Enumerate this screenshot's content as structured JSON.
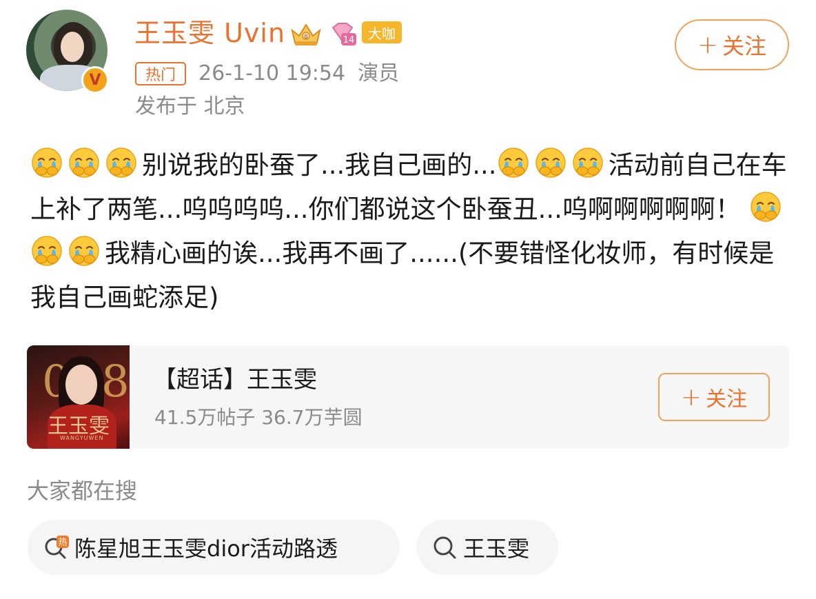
{
  "header": {
    "username": "王玉雯 Uvin",
    "member_tag": "大咖",
    "diamond_level": "14",
    "hot_tag": "热门",
    "timestamp": "26-1-10 19:54",
    "profession": "演员",
    "location": "发布于 北京",
    "follow_label": "关注",
    "verified_badge": "V"
  },
  "post": {
    "segments": {
      "s1": "别说我的卧蚕了...我自己画的...",
      "s2": "活动前自己在车上补了两笔...呜呜呜呜...你们都说这个卧蚕丑...呜啊啊啊啊啊！",
      "s3": "我精心画的诶...我再不画了......(不要错怪化妆师，有时候是我自己画蛇添足)"
    },
    "emoji_name": "crying-cover-mouth-emoji"
  },
  "super_topic": {
    "name": "【超话】王玉雯",
    "stats": "41.5万帖子 36.7万芋圆",
    "follow_label": "关注",
    "cover_title": "王玉雯",
    "cover_subtitle": "WANGYUWEN",
    "cover_number_left": "0",
    "cover_number_right": "8"
  },
  "search": {
    "title": "大家都在搜",
    "items": [
      {
        "label": "陈星旭王玉雯dior活动路透",
        "icon": "hot-search-icon",
        "hot_mark": "热"
      },
      {
        "label": "王玉雯",
        "icon": "search-icon"
      }
    ]
  },
  "colors": {
    "accent": "#e9722e",
    "gold": "#f7b52c",
    "muted": "#8a8a8a",
    "card_bg": "#f6f6f6"
  }
}
